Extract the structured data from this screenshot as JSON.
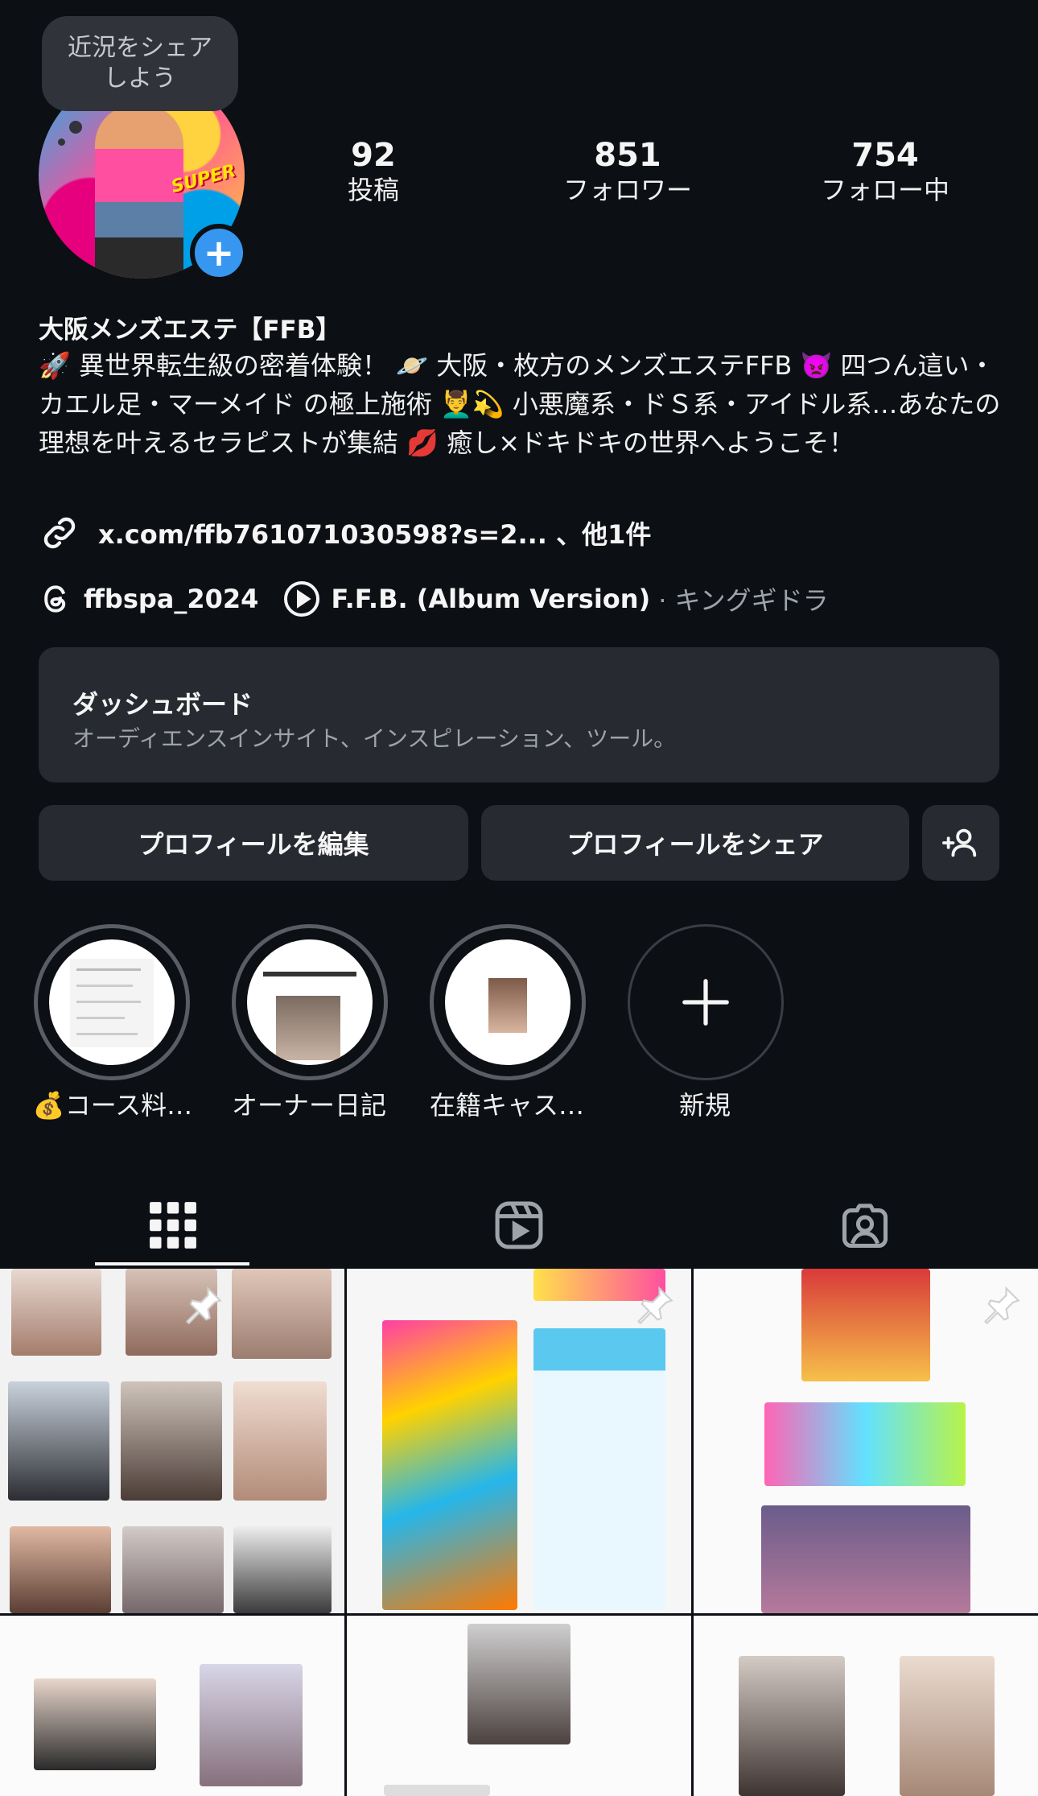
{
  "note": {
    "text": "近況をシェアしよう"
  },
  "stats": [
    {
      "value": "92",
      "label": "投稿"
    },
    {
      "value": "851",
      "label": "フォロワー"
    },
    {
      "value": "754",
      "label": "フォロー中"
    }
  ],
  "profile": {
    "name": "大阪メンズエステ【FFB】",
    "bio": "🚀 異世界転生級の密着体験！ 🪐 大阪・枚方のメンズエステFFB 👿 四つん這い・カエル足・マーメイド の極上施術 💆‍♂️💫 小悪魔系・ドＳ系・アイドル系…あなたの理想を叶えるセラピストが集結 💋 癒し×ドキドキの世界へようこそ！",
    "link": "x.com/ffb761071030598?s=2... 、他1件",
    "threads_handle": "ffbspa_2024",
    "song_title": "F.F.B. (Album Version)",
    "song_artist": "· キングギドラ"
  },
  "dashboard": {
    "title": "ダッシュボード",
    "subtitle": "オーディエンスインサイト、インスピレーション、ツール。"
  },
  "buttons": {
    "edit": "プロフィールを編集",
    "share": "プロフィールをシェア"
  },
  "highlights": [
    {
      "label": "💰コース料…"
    },
    {
      "label": "オーナー日記"
    },
    {
      "label": "在籍キャス…"
    },
    {
      "label": "新規"
    }
  ],
  "tabs": [
    "grid-icon",
    "reels-icon",
    "tagged-icon"
  ],
  "colors": {
    "background": "#0c0f14",
    "accent": "#3797f0",
    "card": "#272b31"
  }
}
